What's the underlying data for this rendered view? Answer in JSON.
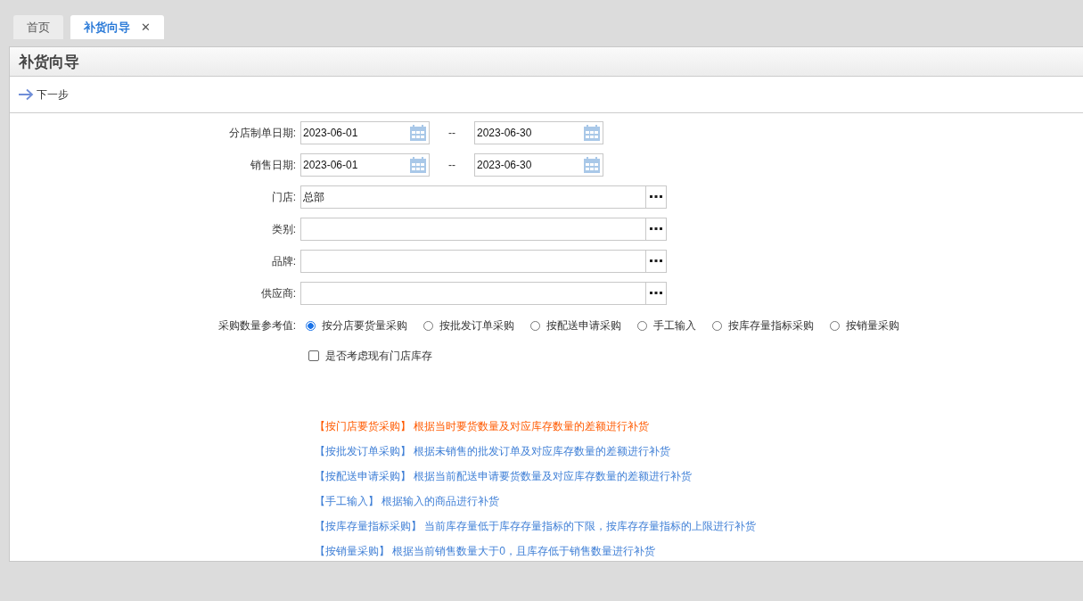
{
  "tabs": [
    {
      "label": "首页",
      "selected": false
    },
    {
      "label": "补货向导",
      "selected": true,
      "close": "✕"
    }
  ],
  "panel": {
    "title": "补货向导",
    "toolbar": {
      "next": "下一步"
    }
  },
  "form": {
    "date_rows": [
      {
        "label": "分店制单日期:",
        "from": "2023-06-01",
        "separator": "--",
        "to": "2023-06-30"
      },
      {
        "label": "销售日期:",
        "from": "2023-06-01",
        "separator": "--",
        "to": "2023-06-30"
      }
    ],
    "picker_rows": [
      {
        "label": "门店:",
        "value": "总部"
      },
      {
        "label": "类别:"
      },
      {
        "label": "品牌:"
      },
      {
        "label": "供应商:"
      }
    ],
    "purchase_basis": {
      "label": "采购数量参考值:",
      "options": [
        {
          "label": "按分店要货量采购",
          "selected": true
        },
        {
          "label": "按批发订单采购",
          "selected": false
        },
        {
          "label": "按配送申请采购",
          "selected": false
        },
        {
          "label": "手工输入",
          "selected": false
        },
        {
          "label": "按库存量指标采购",
          "selected": false
        },
        {
          "label": "按销量采购",
          "selected": false
        }
      ]
    },
    "consider_stock": {
      "label": "是否考虑现有门店库存",
      "checked": false
    }
  },
  "notes": [
    {
      "title": "【按门店要货采购】",
      "text": "根据当时要货数量及对应库存数量的差额进行补货",
      "highlighted": true
    },
    {
      "title": "【按批发订单采购】",
      "text": "根据未销售的批发订单及对应库存数量的差额进行补货",
      "highlighted": false
    },
    {
      "title": "【按配送申请采购】",
      "text": "根据当前配送申请要货数量及对应库存数量的差额进行补货",
      "highlighted": false
    },
    {
      "title": "【手工输入】",
      "text": "根据输入的商品进行补货",
      "highlighted": false
    },
    {
      "title": "【按库存量指标采购】",
      "text": "当前库存量低于库存存量指标的下限，按库存存量指标的上限进行补货",
      "highlighted": false
    },
    {
      "title": "【按销量采购】",
      "text": "根据当前销售数量大于0，且库存低于销售数量进行补货",
      "highlighted": false
    }
  ]
}
